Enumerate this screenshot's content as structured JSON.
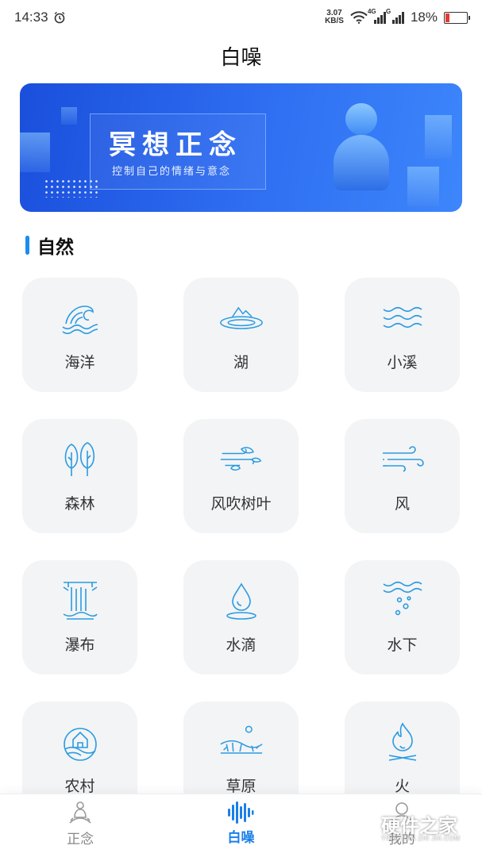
{
  "status_bar": {
    "time": "14:33",
    "net_speed_value": "3.07",
    "net_speed_unit": "KB/S",
    "signal_tag_1": "4G",
    "signal_tag_2": "G",
    "battery_percent": "18%",
    "battery_level": 0.18,
    "battery_color": "#e53935"
  },
  "header": {
    "title": "白噪"
  },
  "banner": {
    "title": "冥想正念",
    "subtitle": "控制自己的情绪与意念"
  },
  "section": {
    "title": "自然",
    "accent_color": "#1a8cf0"
  },
  "sounds": [
    {
      "label": "海洋",
      "icon": "ocean-wave-icon"
    },
    {
      "label": "湖",
      "icon": "lake-icon"
    },
    {
      "label": "小溪",
      "icon": "stream-icon"
    },
    {
      "label": "森林",
      "icon": "forest-icon"
    },
    {
      "label": "风吹树叶",
      "icon": "wind-leaves-icon"
    },
    {
      "label": "风",
      "icon": "wind-icon"
    },
    {
      "label": "瀑布",
      "icon": "waterfall-icon"
    },
    {
      "label": "水滴",
      "icon": "water-drop-icon"
    },
    {
      "label": "水下",
      "icon": "underwater-icon"
    },
    {
      "label": "农村",
      "icon": "countryside-icon"
    },
    {
      "label": "草原",
      "icon": "grassland-icon"
    },
    {
      "label": "火",
      "icon": "fire-icon"
    }
  ],
  "bottom_nav": {
    "items": [
      {
        "label": "正念",
        "icon": "meditation-icon",
        "active": false
      },
      {
        "label": "白噪",
        "icon": "soundwave-icon",
        "active": true
      },
      {
        "label": "我的",
        "icon": "profile-icon",
        "active": false
      }
    ],
    "active_color": "#1a7fe8"
  },
  "watermark": {
    "text": "硬件之家",
    "sub": "YING JIAN ZHI JIA.COM"
  }
}
